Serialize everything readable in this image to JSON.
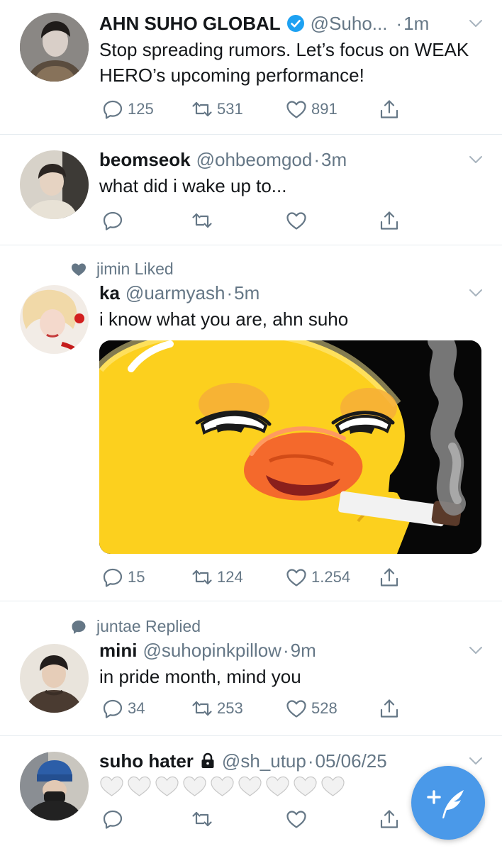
{
  "tweets": [
    {
      "name": "AHN SUHO GLOBAL",
      "handle": "@Suho...",
      "dot": "·",
      "time": "1m",
      "text": "Stop spreading rumors. Let’s focus on WEAK HERO’s upcoming performance!",
      "replies": "125",
      "retweets": "531",
      "likes": "891",
      "verified": true
    },
    {
      "name": "beomseok",
      "handle": "@ohbeomgod",
      "dot": "·",
      "time": "3m",
      "text": "what did i wake up to...",
      "replies": "",
      "retweets": "",
      "likes": ""
    },
    {
      "context": "jimin Liked",
      "name": "ka",
      "handle": "@uarmyash",
      "dot": "·",
      "time": "5m",
      "text": "i know what you are, ahn suho",
      "replies": "15",
      "retweets": "124",
      "likes": "1.254",
      "media": "smoking-duck-sticker"
    },
    {
      "context": "juntae Replied",
      "name": "mini",
      "handle": "@suhopinkpillow",
      "dot": "·",
      "time": "9m",
      "text": "in pride month, mind you",
      "replies": "34",
      "retweets": "253",
      "likes": "528"
    },
    {
      "name": "suho hater",
      "handle": "@sh_utup",
      "dot": "·",
      "time": "05/06/25",
      "text": "🤍🤍🤍🤍🤍🤍🤍🤍🤍",
      "replies": "",
      "retweets": "",
      "likes": "",
      "protected": true
    }
  ],
  "icons": {
    "reply": "reply-icon",
    "retweet": "retweet-icon",
    "like": "heart-icon",
    "share": "share-icon",
    "verified": "verified-badge-icon",
    "lock": "lock-icon",
    "compose": "compose-tweet-icon"
  },
  "colors": {
    "accent": "#1da1f2",
    "fab": "#4a99e9",
    "muted": "#657786",
    "text": "#14171a",
    "divider": "#e6ecf0"
  }
}
